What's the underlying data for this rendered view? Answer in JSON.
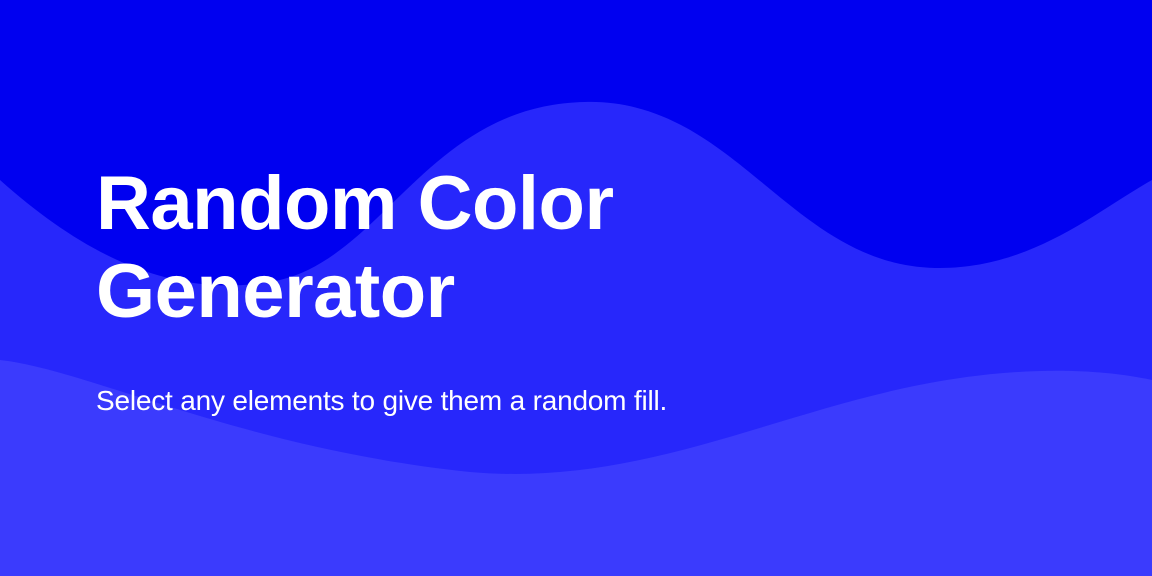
{
  "hero": {
    "title_line_1": "Random Color",
    "title_line_2": "Generator",
    "subtitle": "Select any elements to give them a random fill."
  },
  "colors": {
    "background_top": "#0000f0",
    "wave_middle": "#2727fb",
    "wave_bottom": "#3b3bfd",
    "text": "#ffffff"
  }
}
